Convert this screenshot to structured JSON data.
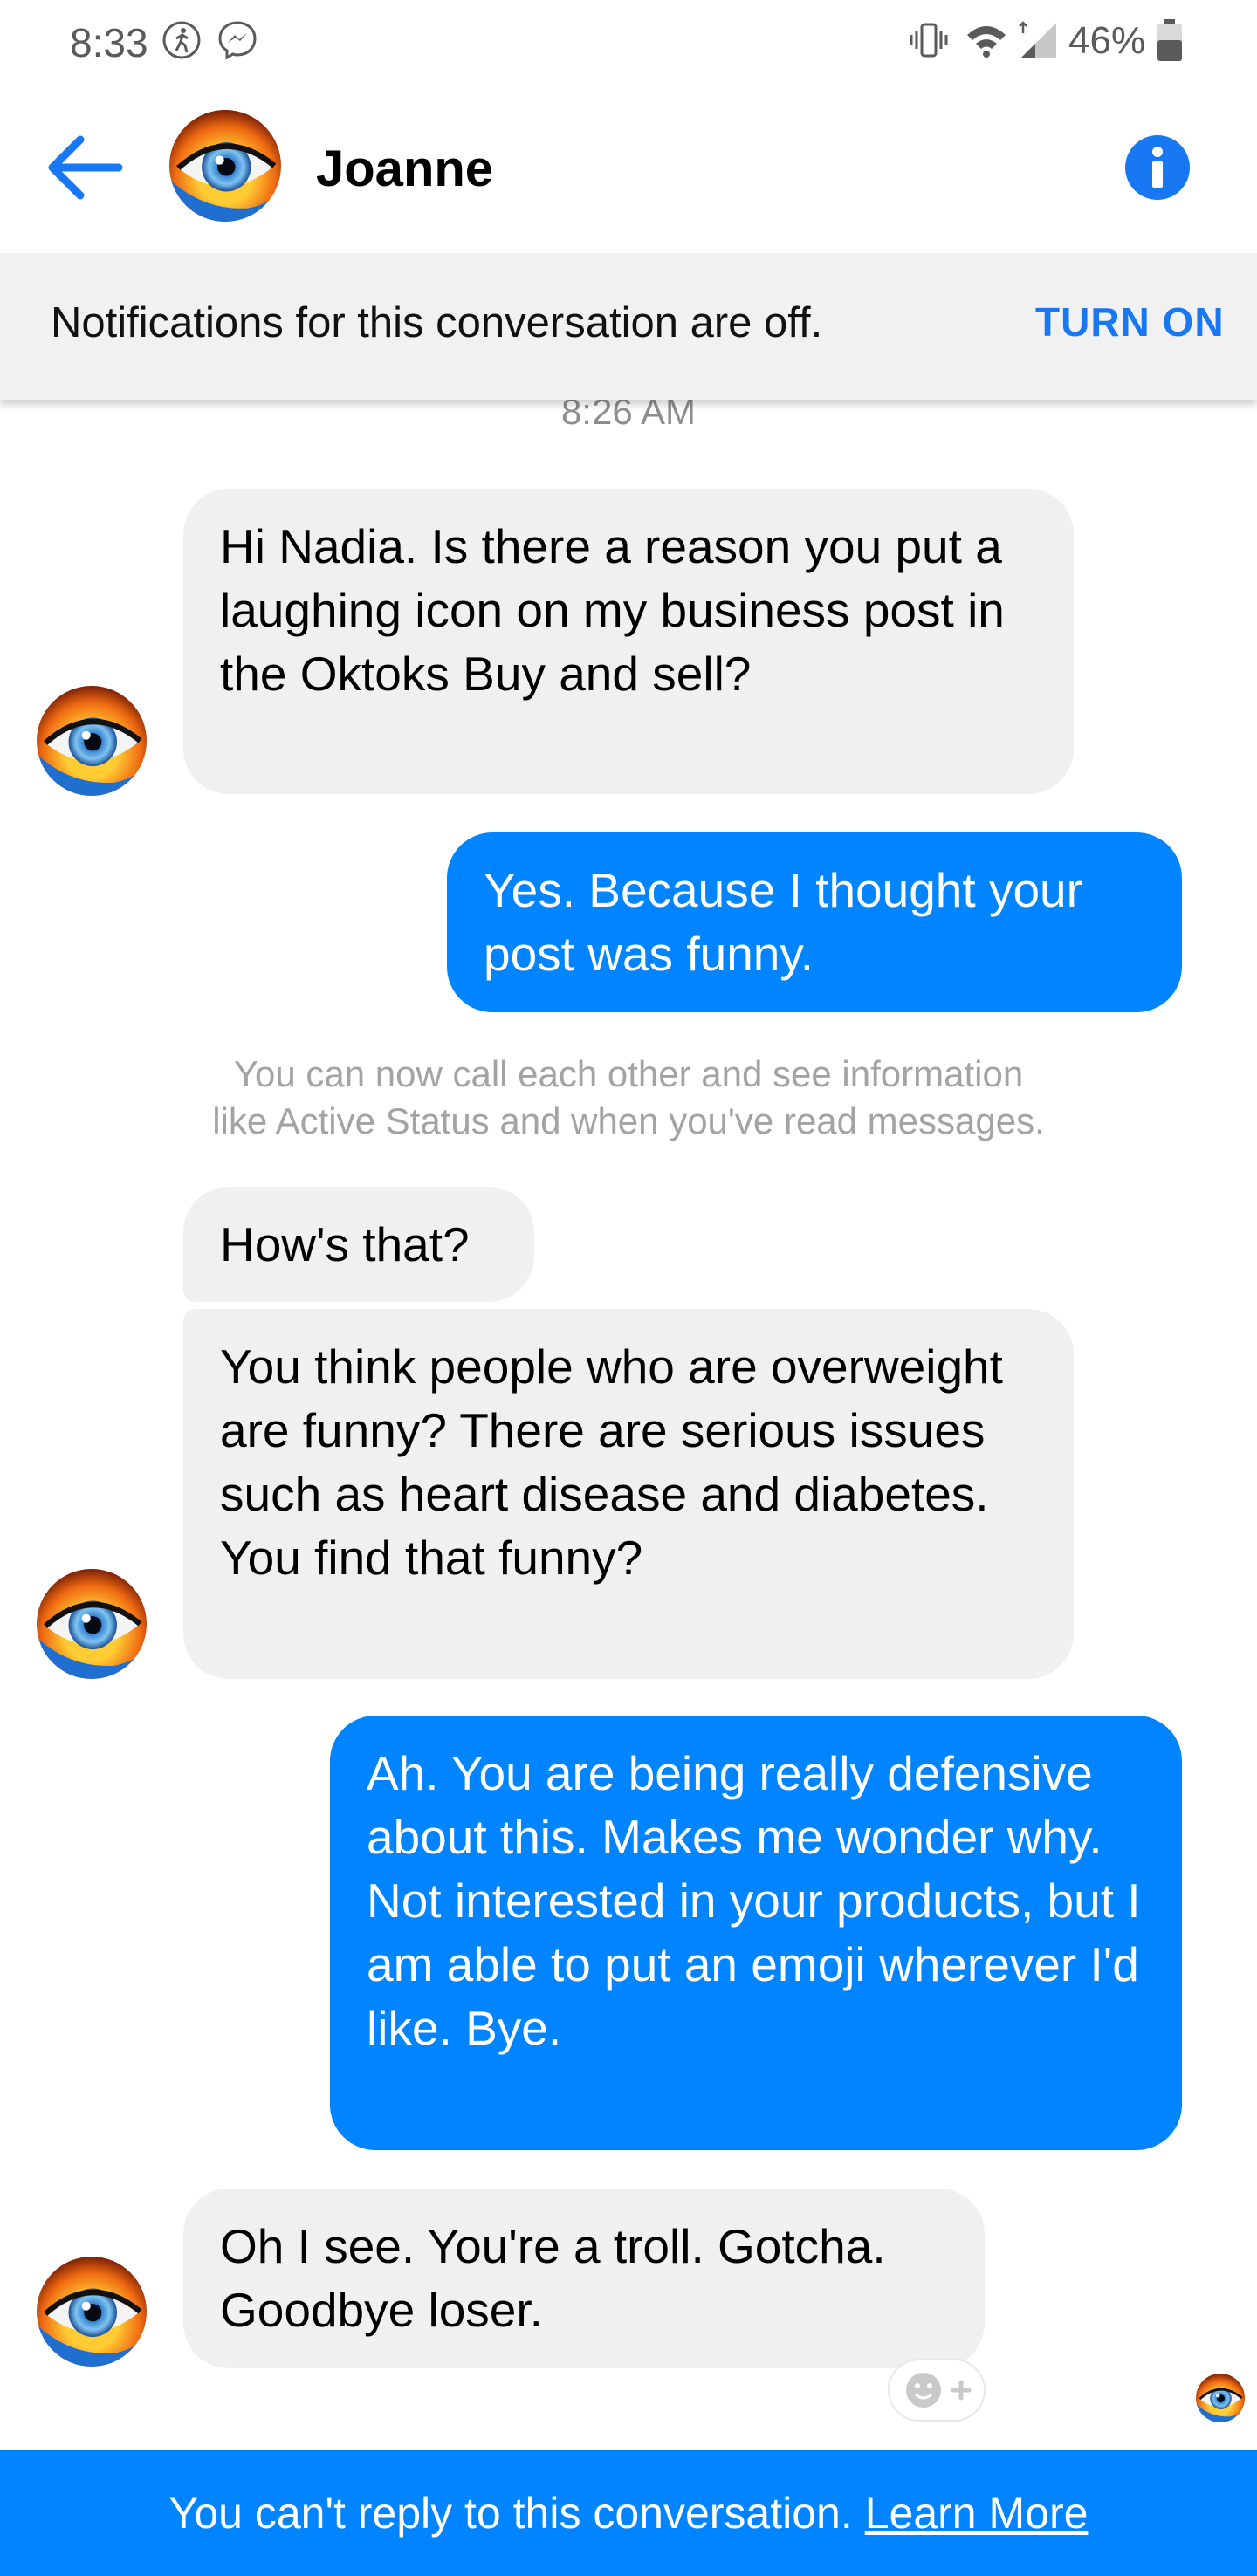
{
  "status_bar": {
    "time": "8:33",
    "battery": "46%",
    "icons": [
      "activity-icon",
      "messenger-icon",
      "vibrate-icon",
      "wifi-icon",
      "signal-icon",
      "battery-icon"
    ]
  },
  "header": {
    "contact_name": "Joanne",
    "icons": [
      "back-arrow-icon",
      "info-icon"
    ],
    "accent_color": "#1877f2"
  },
  "notification_banner": {
    "text": "Notifications for this conversation are off.",
    "action_label": "TURN ON"
  },
  "conversation": {
    "timestamp": "8:26 AM",
    "system_note_line1": "You can now call each other and see information",
    "system_note_line2": "like Active Status and when you've read messages.",
    "messages": [
      {
        "from": "Joanne",
        "text": "Hi Nadia. Is there a reason you put a laughing icon on my business post in the Oktoks Buy and sell?"
      },
      {
        "from": "me",
        "text": "Yes. Because I thought your post was funny."
      },
      {
        "from": "Joanne",
        "text": "How's that?"
      },
      {
        "from": "Joanne",
        "text": "You think people who are overweight are funny? There are serious issues such as heart disease and diabetes. You find that funny?"
      },
      {
        "from": "me",
        "text": "Ah. You are being really defensive about this. Makes me wonder why. Not interested in your products, but I am able to put an emoji wherever I'd like. Bye."
      },
      {
        "from": "Joanne",
        "text": "Oh I see. You're a troll. Gotcha. Goodbye loser."
      }
    ],
    "incoming_bubble_color": "#f0f0f0",
    "outgoing_bubble_color": "#0084ff"
  },
  "bottom_bar": {
    "text": "You can't reply to this conversation.",
    "link": "Learn More",
    "color": "#0084ff"
  }
}
